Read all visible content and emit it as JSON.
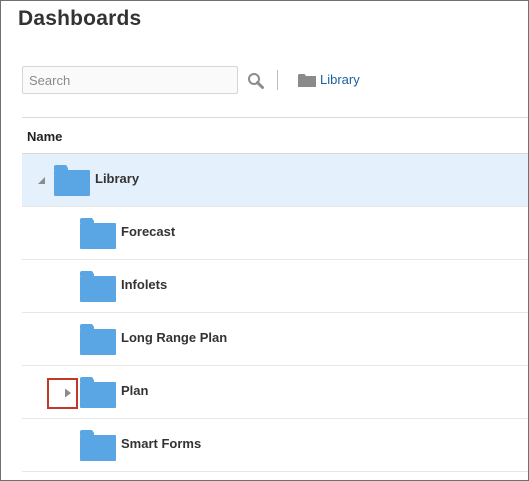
{
  "page": {
    "title": "Dashboards"
  },
  "search": {
    "placeholder": "Search",
    "value": ""
  },
  "breadcrumb": {
    "label": "Library"
  },
  "table": {
    "column_name": "Name"
  },
  "tree": [
    {
      "label": "Library",
      "level": 0,
      "expanded": true,
      "selected": true
    },
    {
      "label": "Forecast",
      "level": 1
    },
    {
      "label": "Infolets",
      "level": 1
    },
    {
      "label": "Long Range Plan",
      "level": 1
    },
    {
      "label": "Plan",
      "level": 1,
      "expandable": true,
      "expanded": false,
      "highlighted": true
    },
    {
      "label": "Smart Forms",
      "level": 1
    }
  ],
  "colors": {
    "folder": "#5aa6e4",
    "selected_row": "#e4f0fb",
    "link": "#1f5f9e",
    "highlight": "#c0392b"
  }
}
